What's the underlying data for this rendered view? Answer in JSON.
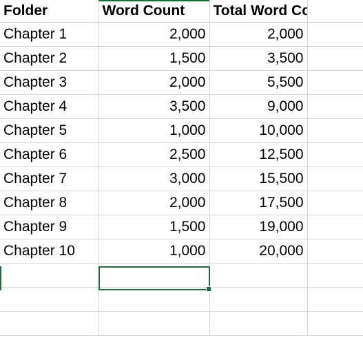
{
  "app": {
    "type": "spreadsheet",
    "accent_color": "#1e6b3c",
    "gridline_color": "#d4d4d4"
  },
  "table": {
    "headers": [
      "Folder",
      "Word Count",
      "Total Word Count",
      ""
    ],
    "rows": [
      {
        "folder": "Chapter 1",
        "word_count": "2,000",
        "total_word_count": "2,000",
        "extra": ""
      },
      {
        "folder": "Chapter 2",
        "word_count": "1,500",
        "total_word_count": "3,500",
        "extra": ""
      },
      {
        "folder": "Chapter 3",
        "word_count": "2,000",
        "total_word_count": "5,500",
        "extra": ""
      },
      {
        "folder": "Chapter 4",
        "word_count": "3,500",
        "total_word_count": "9,000",
        "extra": ""
      },
      {
        "folder": "Chapter 5",
        "word_count": "1,000",
        "total_word_count": "10,000",
        "extra": ""
      },
      {
        "folder": "Chapter 6",
        "word_count": "2,500",
        "total_word_count": "12,500",
        "extra": ""
      },
      {
        "folder": "Chapter 7",
        "word_count": "3,000",
        "total_word_count": "15,500",
        "extra": ""
      },
      {
        "folder": "Chapter 8",
        "word_count": "2,000",
        "total_word_count": "17,500",
        "extra": ""
      },
      {
        "folder": "Chapter 9",
        "word_count": "1,500",
        "total_word_count": "19,000",
        "extra": ""
      },
      {
        "folder": "Chapter 10",
        "word_count": "1,000",
        "total_word_count": "20,000",
        "extra": ""
      },
      {
        "folder": "",
        "word_count": "",
        "total_word_count": "",
        "extra": ""
      },
      {
        "folder": "",
        "word_count": "",
        "total_word_count": "",
        "extra": ""
      },
      {
        "folder": "",
        "word_count": "",
        "total_word_count": "",
        "extra": ""
      }
    ]
  },
  "selection": {
    "column": "Word Count",
    "row_index": 11
  }
}
